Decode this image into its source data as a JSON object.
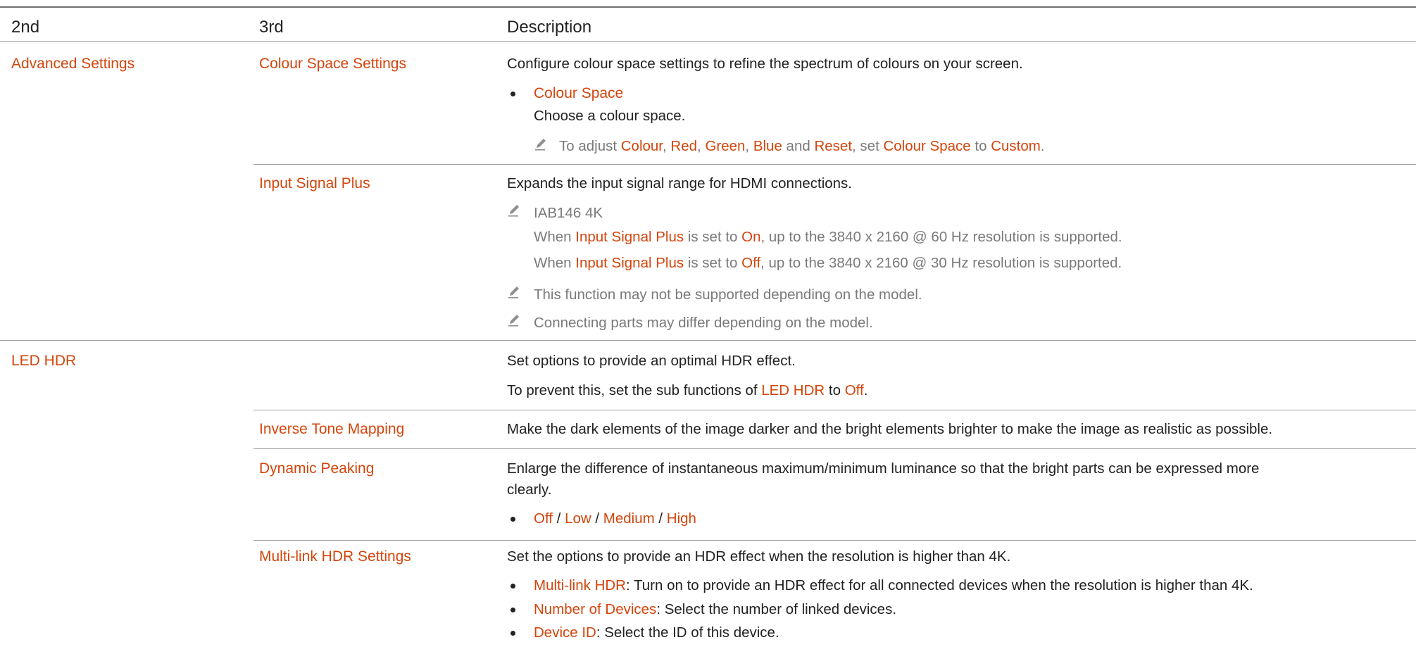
{
  "header": {
    "col2": "2nd",
    "col3": "3rd",
    "col_desc": "Description"
  },
  "colors": {
    "accent": "#d4450c",
    "text": "#222222",
    "note": "#7a7a7a",
    "rule": "#9a9a9a"
  },
  "advanced": {
    "label": "Advanced Settings",
    "colour_space_settings": {
      "label": "Colour Space Settings",
      "desc": "Configure colour space settings to refine the spectrum of colours on your screen.",
      "bullet_label": "Colour Space",
      "bullet_desc": "Choose a colour space.",
      "note": {
        "p1": "To adjust ",
        "k1": "Colour",
        "s1": ", ",
        "k2": "Red",
        "s2": ", ",
        "k3": "Green",
        "s3": ", ",
        "k4": "Blue",
        "s4": " and ",
        "k5": "Reset",
        "s5": ", set ",
        "k6": "Colour Space",
        "s6": " to ",
        "k7": "Custom",
        "s7": "."
      }
    },
    "input_signal_plus": {
      "label": "Input Signal Plus",
      "desc": "Expands the input signal range for HDMI connections.",
      "note_model": "IAB146 4K",
      "on_line": {
        "p1": "When ",
        "k1": "Input Signal Plus",
        "p2": " is set to ",
        "k2": "On",
        "p3": ", up to the 3840 x 2160 @ 60 Hz resolution is supported."
      },
      "off_line": {
        "p1": "When ",
        "k1": "Input Signal Plus",
        "p2": " is set to ",
        "k2": "Off",
        "p3": ", up to the 3840 x 2160 @ 30 Hz resolution is supported."
      },
      "note_support": "This function may not be supported depending on the model.",
      "note_parts": "Connecting parts may differ depending on the model."
    }
  },
  "led_hdr": {
    "label": "LED HDR",
    "desc": "Set options to provide an optimal HDR effect.",
    "prevent": {
      "p1": "To prevent this, set the sub functions of ",
      "k1": "LED HDR",
      "p2": " to ",
      "k2": "Off",
      "p3": "."
    },
    "inverse_tone_mapping": {
      "label": "Inverse Tone Mapping",
      "desc": "Make the dark elements of the image darker and the bright elements brighter to make the image as realistic as possible."
    },
    "dynamic_peaking": {
      "label": "Dynamic Peaking",
      "desc_line1": "Enlarge the difference of instantaneous maximum/minimum luminance so that the bright parts can be expressed more",
      "desc_line2": "clearly.",
      "options": [
        "Off",
        "Low",
        "Medium",
        "High"
      ],
      "sep": " / "
    },
    "multi_link": {
      "label": "Multi-link HDR Settings",
      "desc": "Set the options to provide an HDR effect when the resolution is higher than 4K.",
      "items": [
        {
          "k": "Multi-link HDR",
          "t": ": Turn on to provide an HDR effect for all connected devices when the resolution is higher than 4K."
        },
        {
          "k": "Number of Devices",
          "t": ": Select the number of linked devices."
        },
        {
          "k": "Device ID",
          "t": ": Select the ID of this device."
        }
      ]
    }
  }
}
